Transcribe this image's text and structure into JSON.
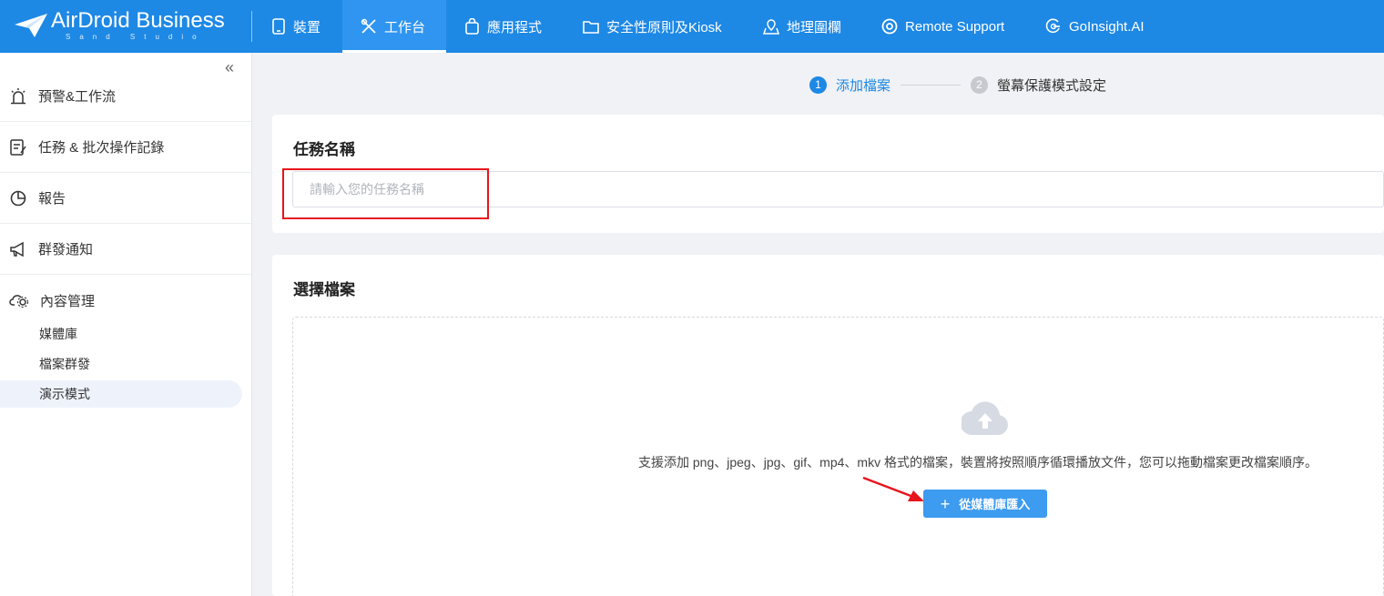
{
  "brand": {
    "name": "AirDroid Business",
    "sub": "Sand Studio"
  },
  "nav": [
    {
      "label": "裝置",
      "icon": "tablet-icon"
    },
    {
      "label": "工作台",
      "icon": "tools-icon"
    },
    {
      "label": "應用程式",
      "icon": "app-bag-icon"
    },
    {
      "label": "安全性原則及Kiosk",
      "icon": "folder-icon"
    },
    {
      "label": "地理圍欄",
      "icon": "geofence-icon"
    },
    {
      "label": "Remote Support",
      "icon": "lifebuoy-icon"
    },
    {
      "label": "GoInsight.AI",
      "icon": "goinsight-icon"
    }
  ],
  "sidebar": {
    "collapse": "«",
    "groups": [
      {
        "label": "預警&工作流",
        "icon": "alarm-icon"
      },
      {
        "label": "任務 & 批次操作記錄",
        "icon": "task-log-icon"
      },
      {
        "label": "報告",
        "icon": "pie-chart-icon"
      },
      {
        "label": "群發通知",
        "icon": "megaphone-icon"
      },
      {
        "label": "內容管理",
        "icon": "cloud-gear-icon"
      }
    ],
    "subitems": [
      {
        "label": "媒體庫"
      },
      {
        "label": "檔案群發"
      },
      {
        "label": "演示模式"
      }
    ]
  },
  "steps": [
    {
      "num": "1",
      "label": "添加檔案"
    },
    {
      "num": "2",
      "label": "螢幕保護模式設定"
    }
  ],
  "task": {
    "title": "任務名稱",
    "placeholder": "請輸入您的任務名稱",
    "value": ""
  },
  "files": {
    "title": "選擇檔案",
    "hint": "支援添加 png、jpeg、jpg、gif、mp4、mkv 格式的檔案，裝置將按照順序循環播放文件，您可以拖動檔案更改檔案順序。",
    "import_plus": "+",
    "import_label": "從媒體庫匯入"
  },
  "colors": {
    "primary": "#1e88e5",
    "button": "#3d9bf0",
    "annotation": "#e8141b"
  }
}
